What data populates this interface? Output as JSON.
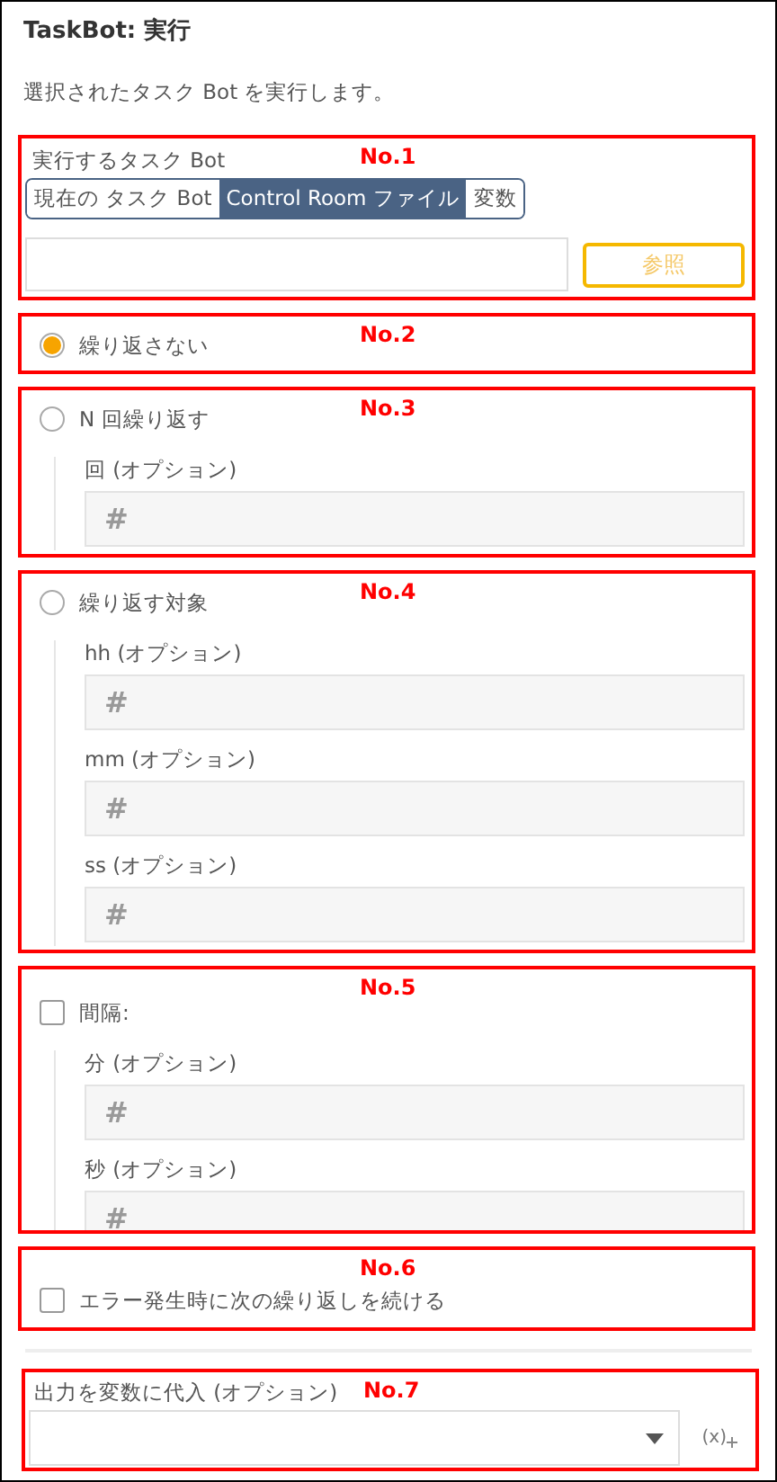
{
  "panel": {
    "title": "TaskBot: 実行",
    "description": "選択されたタスク Bot を実行します。"
  },
  "sections": [
    {
      "kind": "source",
      "annotation": "No.1",
      "label": "実行するタスク Bot",
      "tabs": [
        {
          "label": "現在の タスク Bot",
          "selected": false
        },
        {
          "label": "Control Room ファイル",
          "selected": true
        },
        {
          "label": "変数",
          "selected": false
        }
      ],
      "browse_button": "参照"
    },
    {
      "kind": "radio",
      "annotation": "No.2",
      "label": "繰り返さない",
      "selected": true
    },
    {
      "kind": "radio",
      "annotation": "No.3",
      "label": "N 回繰り返す",
      "selected": false,
      "fields": [
        {
          "label": "回 (オプション)",
          "placeholder": "#"
        }
      ]
    },
    {
      "kind": "radio",
      "annotation": "No.4",
      "label": "繰り返す対象",
      "selected": false,
      "fields": [
        {
          "label": "hh (オプション)",
          "placeholder": "#"
        },
        {
          "label": "mm (オプション)",
          "placeholder": "#"
        },
        {
          "label": "ss (オプション)",
          "placeholder": "#"
        }
      ]
    },
    {
      "kind": "checkbox",
      "annotation": "No.5",
      "label": "間隔:",
      "checked": false,
      "fields": [
        {
          "label": "分 (オプション)",
          "placeholder": "#"
        },
        {
          "label": "秒 (オプション)",
          "placeholder": "#"
        }
      ]
    },
    {
      "kind": "checkbox",
      "annotation": "No.6",
      "label": "エラー発生時に次の繰り返しを続ける",
      "checked": false
    },
    {
      "kind": "output",
      "annotation": "No.7",
      "label": "出力を変数に代入 (オプション)",
      "variable_button": "(x)"
    }
  ]
}
